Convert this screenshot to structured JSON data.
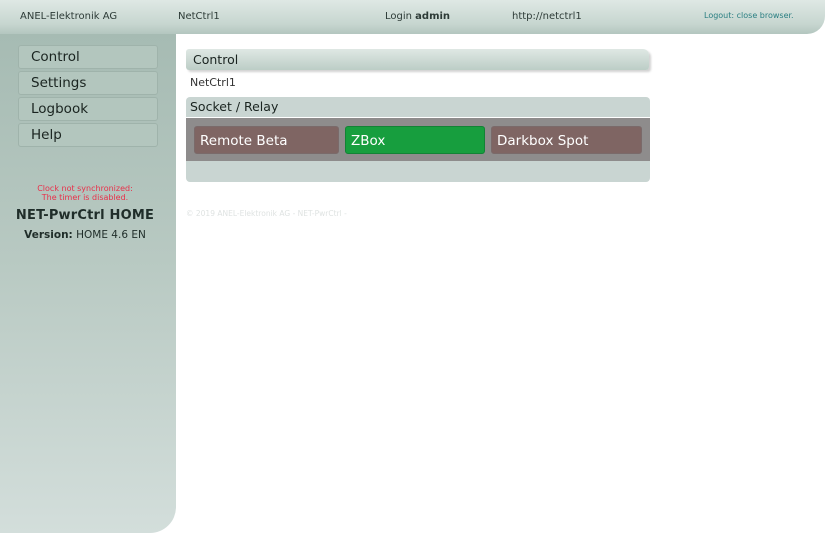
{
  "topbar": {
    "company": "ANEL-Elektronik AG",
    "device": "NetCtrl1",
    "login_prefix": "Login",
    "login_user": "admin",
    "url": "http://netctrl1",
    "logout": "Logout: close browser."
  },
  "sidebar": {
    "items": [
      {
        "label": "Control"
      },
      {
        "label": "Settings"
      },
      {
        "label": "Logbook"
      },
      {
        "label": "Help"
      }
    ],
    "clock_warning_1": "Clock not synchronized:",
    "clock_warning_2": "The timer is disabled.",
    "product": "NET-PwrCtrl HOME",
    "version_label": "Version:",
    "version_value": "HOME 4.6 EN"
  },
  "main": {
    "title": "Control",
    "device_name": "NetCtrl1",
    "section_title": "Socket / Relay",
    "relays": [
      {
        "label": "Remote Beta",
        "state": "off"
      },
      {
        "label": "ZBox",
        "state": "on"
      },
      {
        "label": "Darkbox Spot",
        "state": "off"
      }
    ],
    "copyright": "© 2019 ANEL-Elektronik AG - NET-PwrCtrl -"
  },
  "colors": {
    "relay_off": "#7f6563",
    "relay_on": "#179e3e",
    "warning": "#e8304a",
    "link": "#2a7f82"
  }
}
